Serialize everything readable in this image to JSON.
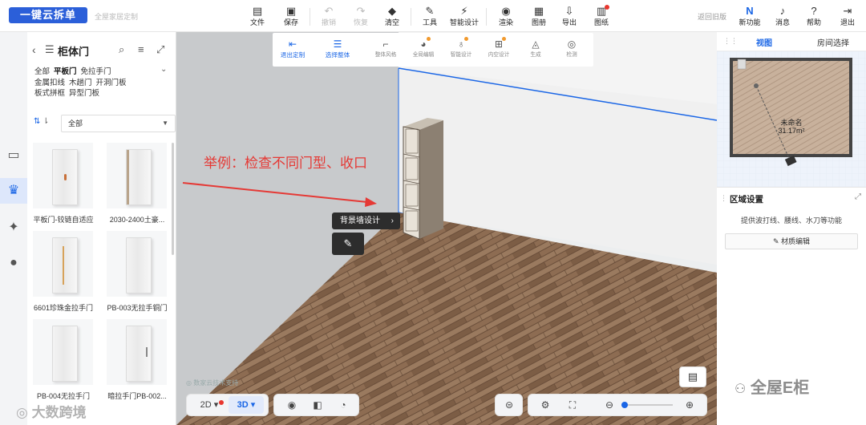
{
  "app": {
    "logo": "一键云拆单",
    "subtitle": "全屋家居定制"
  },
  "toolbar": {
    "file": "文件",
    "save": "保存",
    "undo": "撤销",
    "redo": "恢复",
    "clear": "清空",
    "tools": "工具",
    "smart_design": "智能设计",
    "render": "渲染",
    "album": "图册",
    "export": "导出",
    "drawings": "图纸",
    "return_old": "返回旧版",
    "new_feature": "新功能",
    "messages": "消息",
    "help": "帮助",
    "logout": "退出"
  },
  "subtoolbar": {
    "exit_custom": "退出定制",
    "select_all": "选择整体",
    "overall_style": "整体风格",
    "global_edit": "全局编辑",
    "smart_design": "智能设计",
    "internal_design": "内空设计",
    "generate": "生成",
    "check": "检测"
  },
  "left_panel": {
    "title": "柜体门",
    "categories": [
      "全部",
      "平板门",
      "免拉手门",
      "金属扣线",
      "木趟门",
      "开洞门板",
      "板式拼框",
      "异型门板"
    ],
    "selected_category": "平板门",
    "filter_value": "全部",
    "items": [
      {
        "name": "平板门-铰链自适应"
      },
      {
        "name": "2030-2400土豪..."
      },
      {
        "name": "6601珍珠金拉手门"
      },
      {
        "name": "PB-003无拉手铜门"
      },
      {
        "name": "PB-004无拉手门"
      },
      {
        "name": "暗拉手门PB-002..."
      }
    ]
  },
  "viewport": {
    "annotation": "举例：检查不同门型、收口",
    "tooltip": "背景墙设计",
    "footer_note": "◎ 数家云技术支持"
  },
  "right_panel": {
    "tabs": [
      "视图",
      "房间选择"
    ],
    "active_tab": "视图",
    "room_name": "未命名",
    "room_area": "31.17m²",
    "area_title": "区域设置",
    "area_desc": "提供波打线、腰线、水刀等功能",
    "material_edit": "材质编辑"
  },
  "bottom": {
    "mode_2d": "2D",
    "mode_3d": "3D"
  },
  "watermarks": {
    "left": "大数跨境",
    "right": "全屋E柜"
  },
  "colors": {
    "accent": "#1a66e6",
    "logo_bg": "#2b5fd9",
    "annotation": "#e53935",
    "tooltip_bg": "#2d2d2d"
  }
}
